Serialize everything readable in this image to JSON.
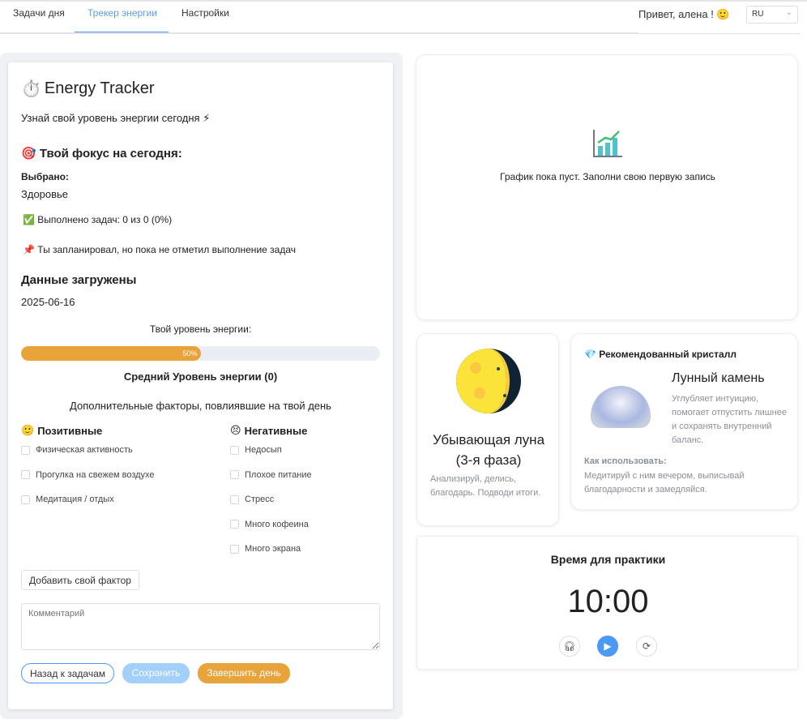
{
  "nav": {
    "tabs": [
      "Задачи дня",
      "Трекер энергии",
      "Настройки"
    ],
    "active": 1,
    "greeting": "Привет, алена ! 🙂",
    "lang": "RU"
  },
  "tracker": {
    "title": "Energy Tracker",
    "subtitle": "Узнай свой уровень энергии сегодня ⚡",
    "focus_title": "Твой фокус на сегодня:",
    "selected_label": "Выбрано:",
    "selected_value": "Здоровье",
    "tasks_done": "Выполнено задач: 0 из 0 (0%)",
    "planned_note": "Ты запланировал, но пока не отметил выполнение задач",
    "data_loaded": "Данные загружены",
    "date": "2025-06-16",
    "energy_label": "Твой уровень энергии:",
    "energy_percent": 50,
    "energy_text": "50%",
    "avg_energy": "Средний Уровень энергии (0)",
    "factors_title": "Дополнительные факторы, повлиявшие на твой день",
    "positive": {
      "title": "Позитивные",
      "items": [
        "Физическая активность",
        "Прогулка на свежем воздухе",
        "Медитация / отдых"
      ]
    },
    "negative": {
      "title": "Негативные",
      "items": [
        "Недосып",
        "Плохое питание",
        "Стресс",
        "Много кофеина",
        "Много экрана"
      ]
    },
    "add_factor": "Добавить свой фактор",
    "comment_placeholder": "Комментарий",
    "back": "Назад к задачам",
    "save": "Сохранить",
    "finish": "Завершить день"
  },
  "chart": {
    "empty": "График пока пуст. Заполни свою первую запись"
  },
  "moon": {
    "phase": "Убывающая луна (3-я фаза)",
    "advice": "Анализируй, делись, благодарь. Подводи итоги."
  },
  "crystal": {
    "header": "Рекомендованный кристалл",
    "name": "Лунный камень",
    "desc": "Углубляет интуицию, помогает отпустить лишнее и сохранять внутренний баланс.",
    "how_label": "Как использовать:",
    "how": "Медитируй с ним вечером, выписывай благодарности и замедляйся."
  },
  "timer": {
    "title": "Время для практики",
    "time": "10:00"
  },
  "colors": {
    "accent": "#4a9af5",
    "orange": "#e8a33b"
  }
}
